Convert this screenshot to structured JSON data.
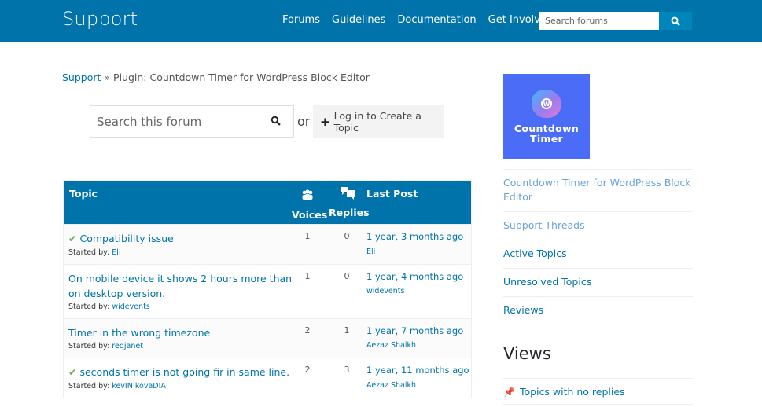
{
  "header": {
    "title": "Support",
    "nav": [
      "Forums",
      "Guidelines",
      "Documentation",
      "Get Involved"
    ],
    "search_placeholder": "Search forums",
    "search_icon": "search-icon",
    "bg_color": "#0073aa"
  },
  "breadcrumb": {
    "root": "Support",
    "separator": " » ",
    "current": "Plugin: Countdown Timer for WordPress Block Editor"
  },
  "forum_search": {
    "placeholder": "Search this forum",
    "or_label": "or",
    "create_topic_label": "Log in to Create a Topic"
  },
  "table": {
    "headers": {
      "topic": "Topic",
      "voices": "Voices",
      "replies": "Replies",
      "last_post": "Last Post"
    },
    "started_by_label": "Started by:",
    "rows": [
      {
        "title": "Compatibility issue",
        "resolved": true,
        "author": "Eli",
        "voices": "1",
        "replies": "0",
        "last_post_time": "1 year, 3 months ago",
        "last_post_user": "Eli"
      },
      {
        "title": "On mobile device it shows 2 hours more than on desktop version.",
        "resolved": false,
        "author": "widevents",
        "voices": "1",
        "replies": "0",
        "last_post_time": "1 year, 4 months ago",
        "last_post_user": "widevents"
      },
      {
        "title": "Timer in the wrong timezone",
        "resolved": false,
        "author": "redjanet",
        "voices": "2",
        "replies": "1",
        "last_post_time": "1 year, 7 months ago",
        "last_post_user": "Aezaz Shaikh"
      },
      {
        "title": "seconds timer is not going fir in same line.",
        "resolved": true,
        "author": "kevIN kovaDIA",
        "voices": "2",
        "replies": "3",
        "last_post_time": "1 year, 11 months ago",
        "last_post_user": "Aezaz Shaikh"
      }
    ]
  },
  "sidebar": {
    "logo_text_line1": "Countdown",
    "logo_text_line2": "Timer",
    "links": [
      "Countdown Timer for WordPress Block Editor",
      "Support Threads",
      "Active Topics",
      "Unresolved Topics",
      "Reviews"
    ],
    "views_title": "Views",
    "views": [
      "Topics with no replies"
    ]
  }
}
